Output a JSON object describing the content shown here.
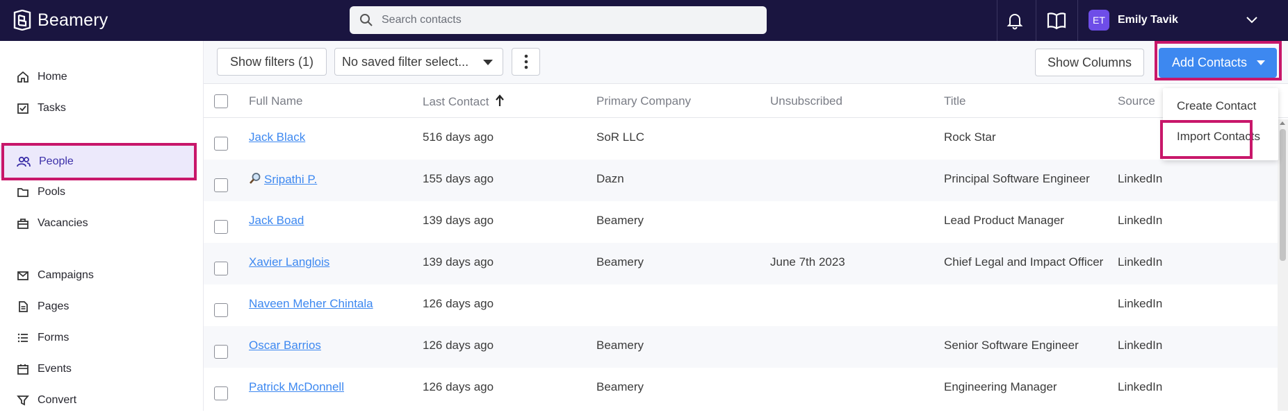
{
  "app": {
    "brand": "Beamery"
  },
  "search": {
    "placeholder": "Search contacts"
  },
  "user": {
    "initials": "ET",
    "name": "Emily Tavik"
  },
  "sidebar": {
    "items": [
      {
        "label": "Home",
        "icon": "home-icon"
      },
      {
        "label": "Tasks",
        "icon": "tasks-icon"
      },
      {
        "label": "People",
        "icon": "people-icon",
        "active": true
      },
      {
        "label": "Pools",
        "icon": "folder-icon"
      },
      {
        "label": "Vacancies",
        "icon": "briefcase-icon"
      },
      {
        "label": "Campaigns",
        "icon": "mail-icon"
      },
      {
        "label": "Pages",
        "icon": "page-icon"
      },
      {
        "label": "Forms",
        "icon": "list-icon"
      },
      {
        "label": "Events",
        "icon": "calendar-icon"
      },
      {
        "label": "Convert",
        "icon": "funnel-icon"
      }
    ]
  },
  "toolbar": {
    "show_filters": "Show filters (1)",
    "saved_filter": "No saved filter select...",
    "show_columns": "Show Columns",
    "add_contacts": "Add Contacts"
  },
  "dropdown": {
    "create_contact": "Create Contact",
    "import_contacts": "Import Contacts"
  },
  "table": {
    "columns": [
      "Full Name",
      "Last Contact",
      "Primary Company",
      "Unsubscribed",
      "Title",
      "Source"
    ],
    "rows": [
      {
        "name": "Jack Black",
        "last_contact": "516 days ago",
        "company": "SoR LLC",
        "unsubscribed": "",
        "title": "Rock Star",
        "source": ""
      },
      {
        "name": "Sripathi P.",
        "last_contact": "155 days ago",
        "company": "Dazn",
        "unsubscribed": "",
        "title": "Principal Software Engineer",
        "source": "LinkedIn"
      },
      {
        "name": "Jack Boad",
        "last_contact": "139 days ago",
        "company": "Beamery",
        "unsubscribed": "",
        "title": "Lead Product Manager",
        "source": "LinkedIn"
      },
      {
        "name": "Xavier Langlois",
        "last_contact": "139 days ago",
        "company": "Beamery",
        "unsubscribed": "June 7th 2023",
        "title": "Chief Legal and Impact Officer",
        "source": "LinkedIn"
      },
      {
        "name": "Naveen Meher Chintala",
        "last_contact": "126 days ago",
        "company": "",
        "unsubscribed": "",
        "title": "",
        "source": "LinkedIn"
      },
      {
        "name": "Oscar Barrios",
        "last_contact": "126 days ago",
        "company": "Beamery",
        "unsubscribed": "",
        "title": "Senior Software Engineer",
        "source": "LinkedIn"
      },
      {
        "name": "Patrick McDonnell",
        "last_contact": "126 days ago",
        "company": "Beamery",
        "unsubscribed": "",
        "title": "Engineering Manager",
        "source": "LinkedIn"
      }
    ]
  },
  "colors": {
    "topbar": "#1a1540",
    "accent": "#3d88f0",
    "highlight": "#c8176a",
    "active_nav": "#ece9fb"
  }
}
